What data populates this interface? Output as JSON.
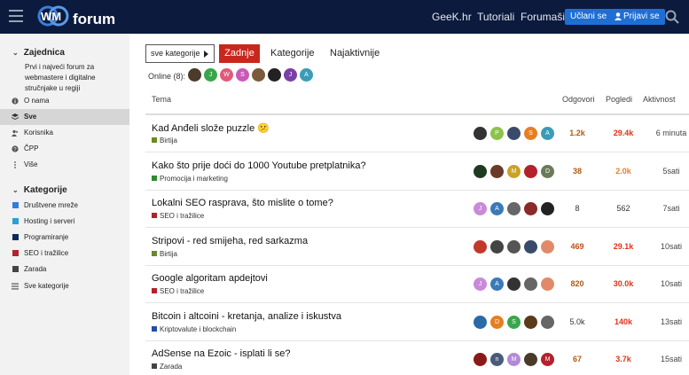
{
  "header": {
    "logo_text": "forum",
    "nav": [
      "GeeK.hr",
      "Tutoriali",
      "Forumaši"
    ],
    "register_label": "Učlani se",
    "login_label": "Prijavi se"
  },
  "sidebar": {
    "section1_title": "Zajednica",
    "section1_desc": "Prvi i najveći forum za webmastere i digitalne stručnjake u regiji",
    "items": [
      {
        "label": "O nama",
        "icon": "info-icon"
      },
      {
        "label": "Sve",
        "icon": "layers-icon",
        "active": true
      },
      {
        "label": "Korisnika",
        "icon": "users-icon"
      },
      {
        "label": "ČPP",
        "icon": "question-icon"
      },
      {
        "label": "Više",
        "icon": "vertical-dots-icon"
      }
    ],
    "section2_title": "Kategorije",
    "categories": [
      {
        "label": "Društvene mreže",
        "color": "#2f7de1"
      },
      {
        "label": "Hosting i serveri",
        "color": "#25a3d8"
      },
      {
        "label": "Programiranje",
        "color": "#0b2a5c"
      },
      {
        "label": "SEO i tražilice",
        "color": "#b3212d"
      },
      {
        "label": "Zarada",
        "color": "#444444"
      }
    ],
    "all_categories_label": "Sve kategorije"
  },
  "main": {
    "category_dropdown": "sve kategorije",
    "tabs": [
      "Zadnje",
      "Kategorije",
      "Najaktivnije"
    ],
    "online_label": "Online (8):",
    "online_users": [
      {
        "letter": "",
        "color": "#4a3b2a"
      },
      {
        "letter": "J",
        "color": "#3aa64b"
      },
      {
        "letter": "W",
        "color": "#e05a7a"
      },
      {
        "letter": "S",
        "color": "#c95ab8"
      },
      {
        "letter": "",
        "color": "#7a5a3a"
      },
      {
        "letter": "",
        "color": "#222222"
      },
      {
        "letter": "J",
        "color": "#7b3fa6"
      },
      {
        "letter": "A",
        "color": "#3a9cb8"
      }
    ],
    "columns": {
      "topic": "Tema",
      "replies": "Odgovori",
      "views": "Pogledi",
      "activity": "Aktivnost"
    },
    "topics": [
      {
        "title": "Kad Anđeli slože puzzle 😕",
        "category": "Birtija",
        "cat_color": "#6a8a1f",
        "posters": [
          {
            "l": "",
            "c": "#333"
          },
          {
            "l": "P",
            "c": "#8bc34a"
          },
          {
            "l": "",
            "c": "#3a4a6a"
          },
          {
            "l": "S",
            "c": "#e67e22"
          },
          {
            "l": "A",
            "c": "#3a9cb8"
          }
        ],
        "replies": "1.2k",
        "views": "29.4k",
        "activity": "6 minuta",
        "replies_color": "#b35a12",
        "views_color": "#e0331a"
      },
      {
        "title": "Kako što prije doći do 1000 Youtube pretplatnika?",
        "category": "Promocija i marketing",
        "cat_color": "#2e8b2e",
        "posters": [
          {
            "l": "",
            "c": "#1f3a1f"
          },
          {
            "l": "",
            "c": "#6a3a2a"
          },
          {
            "l": "M",
            "c": "#c9a227"
          },
          {
            "l": "",
            "c": "#b3212d"
          },
          {
            "l": "D",
            "c": "#6a7a5a"
          }
        ],
        "replies": "38",
        "views": "2.0k",
        "activity": "5sati",
        "replies_color": "#b35a12",
        "views_color": "#e0802a"
      },
      {
        "title": "Lokalni SEO rasprava, što mislite o tome?",
        "category": "SEO i tražilice",
        "cat_color": "#b3212d",
        "posters": [
          {
            "l": "J",
            "c": "#c98ad8"
          },
          {
            "l": "A",
            "c": "#3a7ab8"
          },
          {
            "l": "",
            "c": "#666"
          },
          {
            "l": "",
            "c": "#8a2a2a"
          },
          {
            "l": "",
            "c": "#222"
          }
        ],
        "replies": "8",
        "views": "562",
        "activity": "7sati",
        "replies_color": "#333333",
        "views_color": "#333333"
      },
      {
        "title": "Stripovi - red smijeha, red sarkazma",
        "category": "Birtija",
        "cat_color": "#6a8a1f",
        "posters": [
          {
            "l": "",
            "c": "#c0392b"
          },
          {
            "l": "",
            "c": "#444"
          },
          {
            "l": "",
            "c": "#555"
          },
          {
            "l": "",
            "c": "#3a4a6a"
          },
          {
            "l": "",
            "c": "#e08a6a"
          }
        ],
        "replies": "469",
        "views": "29.1k",
        "activity": "10sati",
        "replies_color": "#c0501a",
        "views_color": "#e0331a"
      },
      {
        "title": "Google algoritam apdejtovi",
        "category": "SEO i tražilice",
        "cat_color": "#b3212d",
        "posters": [
          {
            "l": "J",
            "c": "#c98ad8"
          },
          {
            "l": "A",
            "c": "#3a7ab8"
          },
          {
            "l": "",
            "c": "#333"
          },
          {
            "l": "",
            "c": "#666"
          },
          {
            "l": "",
            "c": "#e08a6a"
          }
        ],
        "replies": "820",
        "views": "30.0k",
        "activity": "10sati",
        "replies_color": "#b35a12",
        "views_color": "#e0331a"
      },
      {
        "title": "Bitcoin i altcoini - kretanja, analize i iskustva",
        "category": "Kriptovalute i blockchain",
        "cat_color": "#1f4fa8",
        "posters": [
          {
            "l": "",
            "c": "#2a6aa8"
          },
          {
            "l": "D",
            "c": "#e67e22"
          },
          {
            "l": "S",
            "c": "#3aa64b"
          },
          {
            "l": "",
            "c": "#5a3a1a"
          },
          {
            "l": "",
            "c": "#666"
          }
        ],
        "replies": "5.0k",
        "views": "140k",
        "activity": "13sati",
        "replies_color": "#333333",
        "views_color": "#e0331a"
      },
      {
        "title": "AdSense na Ezoic - isplati li se?",
        "category": "Zarada",
        "cat_color": "#444444",
        "posters": [
          {
            "l": "",
            "c": "#8a1a1a"
          },
          {
            "l": "n",
            "c": "#4a5a7a"
          },
          {
            "l": "M",
            "c": "#b38ad8"
          },
          {
            "l": "",
            "c": "#4a3a2a"
          },
          {
            "l": "M",
            "c": "#b3212d"
          }
        ],
        "replies": "67",
        "views": "3.7k",
        "activity": "15sati",
        "replies_color": "#b35a12",
        "views_color": "#e0331a"
      }
    ]
  }
}
